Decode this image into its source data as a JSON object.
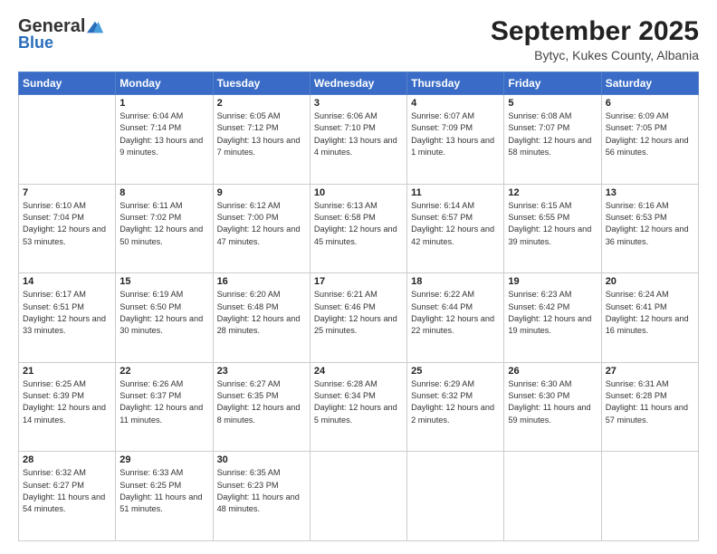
{
  "logo": {
    "general": "General",
    "blue": "Blue"
  },
  "header": {
    "month": "September 2025",
    "location": "Bytyc, Kukes County, Albania"
  },
  "weekdays": [
    "Sunday",
    "Monday",
    "Tuesday",
    "Wednesday",
    "Thursday",
    "Friday",
    "Saturday"
  ],
  "weeks": [
    [
      {
        "day": "",
        "sunrise": "",
        "sunset": "",
        "daylight": ""
      },
      {
        "day": "1",
        "sunrise": "Sunrise: 6:04 AM",
        "sunset": "Sunset: 7:14 PM",
        "daylight": "Daylight: 13 hours and 9 minutes."
      },
      {
        "day": "2",
        "sunrise": "Sunrise: 6:05 AM",
        "sunset": "Sunset: 7:12 PM",
        "daylight": "Daylight: 13 hours and 7 minutes."
      },
      {
        "day": "3",
        "sunrise": "Sunrise: 6:06 AM",
        "sunset": "Sunset: 7:10 PM",
        "daylight": "Daylight: 13 hours and 4 minutes."
      },
      {
        "day": "4",
        "sunrise": "Sunrise: 6:07 AM",
        "sunset": "Sunset: 7:09 PM",
        "daylight": "Daylight: 13 hours and 1 minute."
      },
      {
        "day": "5",
        "sunrise": "Sunrise: 6:08 AM",
        "sunset": "Sunset: 7:07 PM",
        "daylight": "Daylight: 12 hours and 58 minutes."
      },
      {
        "day": "6",
        "sunrise": "Sunrise: 6:09 AM",
        "sunset": "Sunset: 7:05 PM",
        "daylight": "Daylight: 12 hours and 56 minutes."
      }
    ],
    [
      {
        "day": "7",
        "sunrise": "Sunrise: 6:10 AM",
        "sunset": "Sunset: 7:04 PM",
        "daylight": "Daylight: 12 hours and 53 minutes."
      },
      {
        "day": "8",
        "sunrise": "Sunrise: 6:11 AM",
        "sunset": "Sunset: 7:02 PM",
        "daylight": "Daylight: 12 hours and 50 minutes."
      },
      {
        "day": "9",
        "sunrise": "Sunrise: 6:12 AM",
        "sunset": "Sunset: 7:00 PM",
        "daylight": "Daylight: 12 hours and 47 minutes."
      },
      {
        "day": "10",
        "sunrise": "Sunrise: 6:13 AM",
        "sunset": "Sunset: 6:58 PM",
        "daylight": "Daylight: 12 hours and 45 minutes."
      },
      {
        "day": "11",
        "sunrise": "Sunrise: 6:14 AM",
        "sunset": "Sunset: 6:57 PM",
        "daylight": "Daylight: 12 hours and 42 minutes."
      },
      {
        "day": "12",
        "sunrise": "Sunrise: 6:15 AM",
        "sunset": "Sunset: 6:55 PM",
        "daylight": "Daylight: 12 hours and 39 minutes."
      },
      {
        "day": "13",
        "sunrise": "Sunrise: 6:16 AM",
        "sunset": "Sunset: 6:53 PM",
        "daylight": "Daylight: 12 hours and 36 minutes."
      }
    ],
    [
      {
        "day": "14",
        "sunrise": "Sunrise: 6:17 AM",
        "sunset": "Sunset: 6:51 PM",
        "daylight": "Daylight: 12 hours and 33 minutes."
      },
      {
        "day": "15",
        "sunrise": "Sunrise: 6:19 AM",
        "sunset": "Sunset: 6:50 PM",
        "daylight": "Daylight: 12 hours and 30 minutes."
      },
      {
        "day": "16",
        "sunrise": "Sunrise: 6:20 AM",
        "sunset": "Sunset: 6:48 PM",
        "daylight": "Daylight: 12 hours and 28 minutes."
      },
      {
        "day": "17",
        "sunrise": "Sunrise: 6:21 AM",
        "sunset": "Sunset: 6:46 PM",
        "daylight": "Daylight: 12 hours and 25 minutes."
      },
      {
        "day": "18",
        "sunrise": "Sunrise: 6:22 AM",
        "sunset": "Sunset: 6:44 PM",
        "daylight": "Daylight: 12 hours and 22 minutes."
      },
      {
        "day": "19",
        "sunrise": "Sunrise: 6:23 AM",
        "sunset": "Sunset: 6:42 PM",
        "daylight": "Daylight: 12 hours and 19 minutes."
      },
      {
        "day": "20",
        "sunrise": "Sunrise: 6:24 AM",
        "sunset": "Sunset: 6:41 PM",
        "daylight": "Daylight: 12 hours and 16 minutes."
      }
    ],
    [
      {
        "day": "21",
        "sunrise": "Sunrise: 6:25 AM",
        "sunset": "Sunset: 6:39 PM",
        "daylight": "Daylight: 12 hours and 14 minutes."
      },
      {
        "day": "22",
        "sunrise": "Sunrise: 6:26 AM",
        "sunset": "Sunset: 6:37 PM",
        "daylight": "Daylight: 12 hours and 11 minutes."
      },
      {
        "day": "23",
        "sunrise": "Sunrise: 6:27 AM",
        "sunset": "Sunset: 6:35 PM",
        "daylight": "Daylight: 12 hours and 8 minutes."
      },
      {
        "day": "24",
        "sunrise": "Sunrise: 6:28 AM",
        "sunset": "Sunset: 6:34 PM",
        "daylight": "Daylight: 12 hours and 5 minutes."
      },
      {
        "day": "25",
        "sunrise": "Sunrise: 6:29 AM",
        "sunset": "Sunset: 6:32 PM",
        "daylight": "Daylight: 12 hours and 2 minutes."
      },
      {
        "day": "26",
        "sunrise": "Sunrise: 6:30 AM",
        "sunset": "Sunset: 6:30 PM",
        "daylight": "Daylight: 11 hours and 59 minutes."
      },
      {
        "day": "27",
        "sunrise": "Sunrise: 6:31 AM",
        "sunset": "Sunset: 6:28 PM",
        "daylight": "Daylight: 11 hours and 57 minutes."
      }
    ],
    [
      {
        "day": "28",
        "sunrise": "Sunrise: 6:32 AM",
        "sunset": "Sunset: 6:27 PM",
        "daylight": "Daylight: 11 hours and 54 minutes."
      },
      {
        "day": "29",
        "sunrise": "Sunrise: 6:33 AM",
        "sunset": "Sunset: 6:25 PM",
        "daylight": "Daylight: 11 hours and 51 minutes."
      },
      {
        "day": "30",
        "sunrise": "Sunrise: 6:35 AM",
        "sunset": "Sunset: 6:23 PM",
        "daylight": "Daylight: 11 hours and 48 minutes."
      },
      {
        "day": "",
        "sunrise": "",
        "sunset": "",
        "daylight": ""
      },
      {
        "day": "",
        "sunrise": "",
        "sunset": "",
        "daylight": ""
      },
      {
        "day": "",
        "sunrise": "",
        "sunset": "",
        "daylight": ""
      },
      {
        "day": "",
        "sunrise": "",
        "sunset": "",
        "daylight": ""
      }
    ]
  ]
}
